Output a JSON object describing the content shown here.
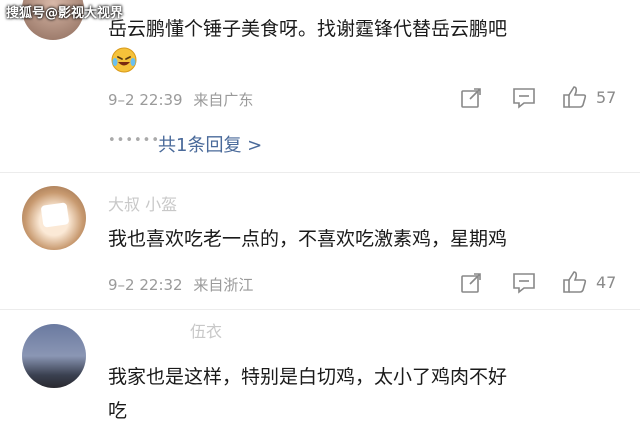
{
  "watermark": "搜狐号@影视大视界",
  "comments": [
    {
      "text": "岳云鹏懂个锤子美食呀。找谢霆锋代替岳云鹏吧",
      "time": "9–2 22:39",
      "location": "来自广东",
      "likes": "57",
      "emoji": "laughing-crying-emoji",
      "replies_label": "共1条回复 >"
    },
    {
      "username": "大叔 小盔",
      "text": "我也喜欢吃老一点的，不喜欢吃激素鸡，星期鸡",
      "time": "9–2 22:32",
      "location": "来自浙江",
      "likes": "47"
    },
    {
      "username": "伍衣",
      "text_line1": "我家也是这样，特别是白切鸡，太小了鸡肉不好",
      "text_line2": "吃"
    }
  ],
  "icons": {
    "share": "share-icon",
    "comment": "comment-icon",
    "like": "thumbs-up-icon"
  }
}
